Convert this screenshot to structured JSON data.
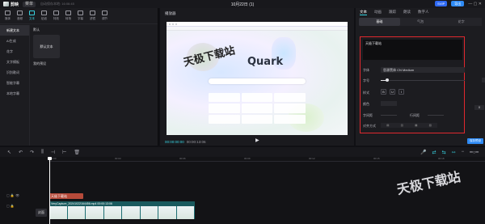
{
  "titlebar": {
    "app_name": "剪映",
    "menu_label": "菜单",
    "autosave_text": "自动保存本地: 16:06:45",
    "doc_title": "10月22日 (1)",
    "svip_label": "SVIP",
    "export_label": "导出",
    "window_controls": "—  ▢  ✕"
  },
  "media_tools": [
    {
      "label": "媒体",
      "icon": "media-icon",
      "active": false
    },
    {
      "label": "音频",
      "icon": "audio-icon",
      "active": false
    },
    {
      "label": "文本",
      "icon": "text-icon",
      "active": true
    },
    {
      "label": "贴纸",
      "icon": "sticker-icon",
      "active": false
    },
    {
      "label": "特效",
      "icon": "effects-icon",
      "active": false
    },
    {
      "label": "转场",
      "icon": "transition-icon",
      "active": false
    },
    {
      "label": "字幕",
      "icon": "caption-icon",
      "active": false
    },
    {
      "label": "滤镜",
      "icon": "filter-icon",
      "active": false
    },
    {
      "label": "调节",
      "icon": "adjust-icon",
      "active": false
    }
  ],
  "sidebar": {
    "items": [
      {
        "label": "新建文本",
        "active": true
      },
      {
        "label": "AI生成",
        "active": false
      },
      {
        "label": "花字",
        "active": false
      },
      {
        "label": "文字模板",
        "active": false
      },
      {
        "label": "识别歌词",
        "active": false
      },
      {
        "label": "智能字幕",
        "active": false
      },
      {
        "label": "本地字幕",
        "active": false
      }
    ]
  },
  "content": {
    "section_default": "默认",
    "default_card": "默认文本",
    "section_favorites": "我的预设"
  },
  "player": {
    "title": "播放器",
    "quark_logo": "Quark",
    "current_time": "00:00:00:00",
    "total_time": "00:00:13:06",
    "play_icon": "▶"
  },
  "props": {
    "tabs": [
      {
        "label": "文本",
        "active": true
      },
      {
        "label": "动画",
        "active": false
      },
      {
        "label": "跟踪",
        "active": false
      },
      {
        "label": "朗读",
        "active": false
      },
      {
        "label": "数字人",
        "active": false
      }
    ],
    "subtabs": [
      {
        "label": "基础",
        "active": true
      },
      {
        "label": "气泡",
        "active": false
      },
      {
        "label": "花字",
        "active": false
      }
    ],
    "text_value": "天极下载站",
    "font_label": "字体",
    "font_value": "思源黑体 CN Medium",
    "size_label": "字号",
    "size_value": "6",
    "size_level": 0.08,
    "style_label": "样式",
    "style_buttons": [
      "B",
      "U",
      "I"
    ],
    "color_label": "颜色",
    "char_spacing_label": "字间距",
    "line_spacing_label": "行间距",
    "align_label": "对齐方式",
    "extra_value": "0",
    "save_preset": "保存预设"
  },
  "timeline": {
    "ruler_marks": [
      "00:00",
      "00:03",
      "00:06",
      "00:09",
      "00:12",
      "00:15",
      "00:18"
    ],
    "text_clip": "天极下载站",
    "video_clip": "VeryCapture_20241022164456.mp4  00:00:13:06",
    "cover_label": "封面"
  },
  "watermarks": {
    "center": "天极下载站",
    "bottom_right": "天极下载站"
  },
  "colors": {
    "accent": "#37d2e0",
    "highlight_box": "#e0282e",
    "export": "#2f8bf5",
    "text_clip": "#b54a3a",
    "video_clip": "#1d6e72"
  }
}
